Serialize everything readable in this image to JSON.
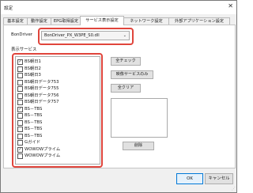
{
  "window": {
    "title": "設定",
    "close_glyph": "✕",
    "grip_glyph": "⋰"
  },
  "tabs": [
    {
      "label": "基本設定",
      "active": false
    },
    {
      "label": "動作設定",
      "active": false
    },
    {
      "label": "EPG取得設定",
      "active": false
    },
    {
      "label": "サービス表示設定",
      "active": true
    },
    {
      "label": "ネットワーク設定",
      "active": false
    },
    {
      "label": "外部アプリケーション設定",
      "active": false
    }
  ],
  "bondriver": {
    "label": "BonDriver",
    "selected": "BonDriver_PX_W3PE_S0.dll",
    "chevron": "⌄"
  },
  "services": {
    "label": "表示サービス",
    "items": [
      {
        "name": "BS朝日1",
        "checked": true
      },
      {
        "name": "BS朝日2",
        "checked": false
      },
      {
        "name": "BS朝日3",
        "checked": false
      },
      {
        "name": "BS朝日データ753",
        "checked": false
      },
      {
        "name": "BS朝日データ755",
        "checked": false
      },
      {
        "name": "BS朝日データ756",
        "checked": false
      },
      {
        "name": "BS朝日データ757",
        "checked": false
      },
      {
        "name": "BS－TBS",
        "checked": true
      },
      {
        "name": "BS－TBS",
        "checked": false
      },
      {
        "name": "BS－TBS",
        "checked": false
      },
      {
        "name": "BS－TBS",
        "checked": false
      },
      {
        "name": "BS－TBS",
        "checked": false
      },
      {
        "name": "Gガイド",
        "checked": false
      },
      {
        "name": "WOWOWプライム",
        "checked": true
      },
      {
        "name": "WOWOWプライム",
        "checked": false
      }
    ]
  },
  "buttons": {
    "check_all": "全チェック",
    "video_only": "映像サービスのみ",
    "clear_all": "全クリア",
    "delete": "削除",
    "ok": "OK",
    "cancel": "キャンセル"
  },
  "colors": {
    "highlight": "#e0453c"
  }
}
